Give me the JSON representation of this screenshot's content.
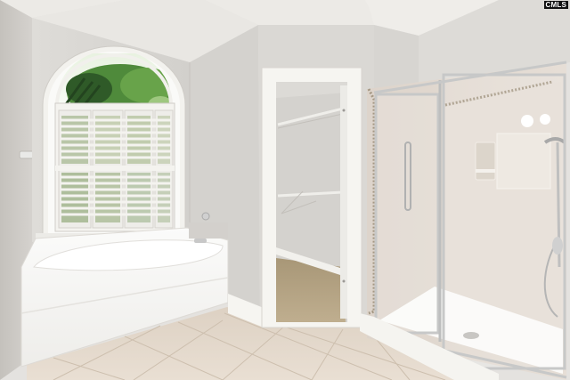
{
  "photo": {
    "watermark": "CMLS"
  },
  "palette": {
    "wall": "#d9d7d3",
    "wall_shadow": "#c9c6c1",
    "ceiling": "#ebe9e5",
    "trim": "#f6f5f1",
    "tile": "#e3d8cb",
    "closet_carpet": "#b7a688",
    "glass_frame": "#c7c8c8",
    "foliage": "#4f8a3b"
  }
}
